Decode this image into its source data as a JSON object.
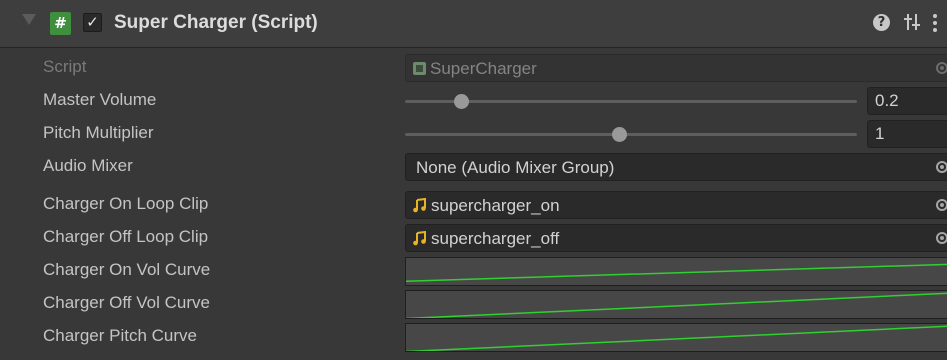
{
  "component": {
    "title": "Super Charger (Script)",
    "enabled": true,
    "script_icon_glyph": "#",
    "checkbox_glyph": "✓",
    "help_glyph": "?",
    "icons": {
      "script": "script-icon",
      "help": "help-icon",
      "presets": "presets-icon",
      "menu": "kebab-menu-icon",
      "audio_clip": "audio-clip-icon",
      "object_picker": "object-picker-icon"
    }
  },
  "fields": {
    "script": {
      "label": "Script",
      "value": "SuperCharger"
    },
    "master_volume": {
      "label": "Master Volume",
      "value": "0.2",
      "slider_fraction": 0.125
    },
    "pitch_multiplier": {
      "label": "Pitch Multiplier",
      "value": "1",
      "slider_fraction": 0.475
    },
    "audio_mixer": {
      "label": "Audio Mixer",
      "value": "None (Audio Mixer Group)"
    },
    "charger_on_loop_clip": {
      "label": "Charger On Loop Clip",
      "value": "supercharger_on"
    },
    "charger_off_loop_clip": {
      "label": "Charger Off Loop Clip",
      "value": "supercharger_off"
    },
    "charger_on_vol_curve": {
      "label": "Charger On Vol Curve",
      "curve": {
        "start": 0.2,
        "end": 0.8
      }
    },
    "charger_off_vol_curve": {
      "label": "Charger Off Vol Curve",
      "curve": {
        "start": 0.05,
        "end": 0.95
      }
    },
    "charger_pitch_curve": {
      "label": "Charger Pitch Curve",
      "curve": {
        "start": 0.05,
        "end": 0.95
      }
    }
  },
  "colors": {
    "background": "#383838",
    "header": "#3e3e3e",
    "field": "#2a2a2a",
    "curve_line": "#2fd02f",
    "script_icon": "#3f8f3e",
    "audio_icon": "#e8b423"
  }
}
